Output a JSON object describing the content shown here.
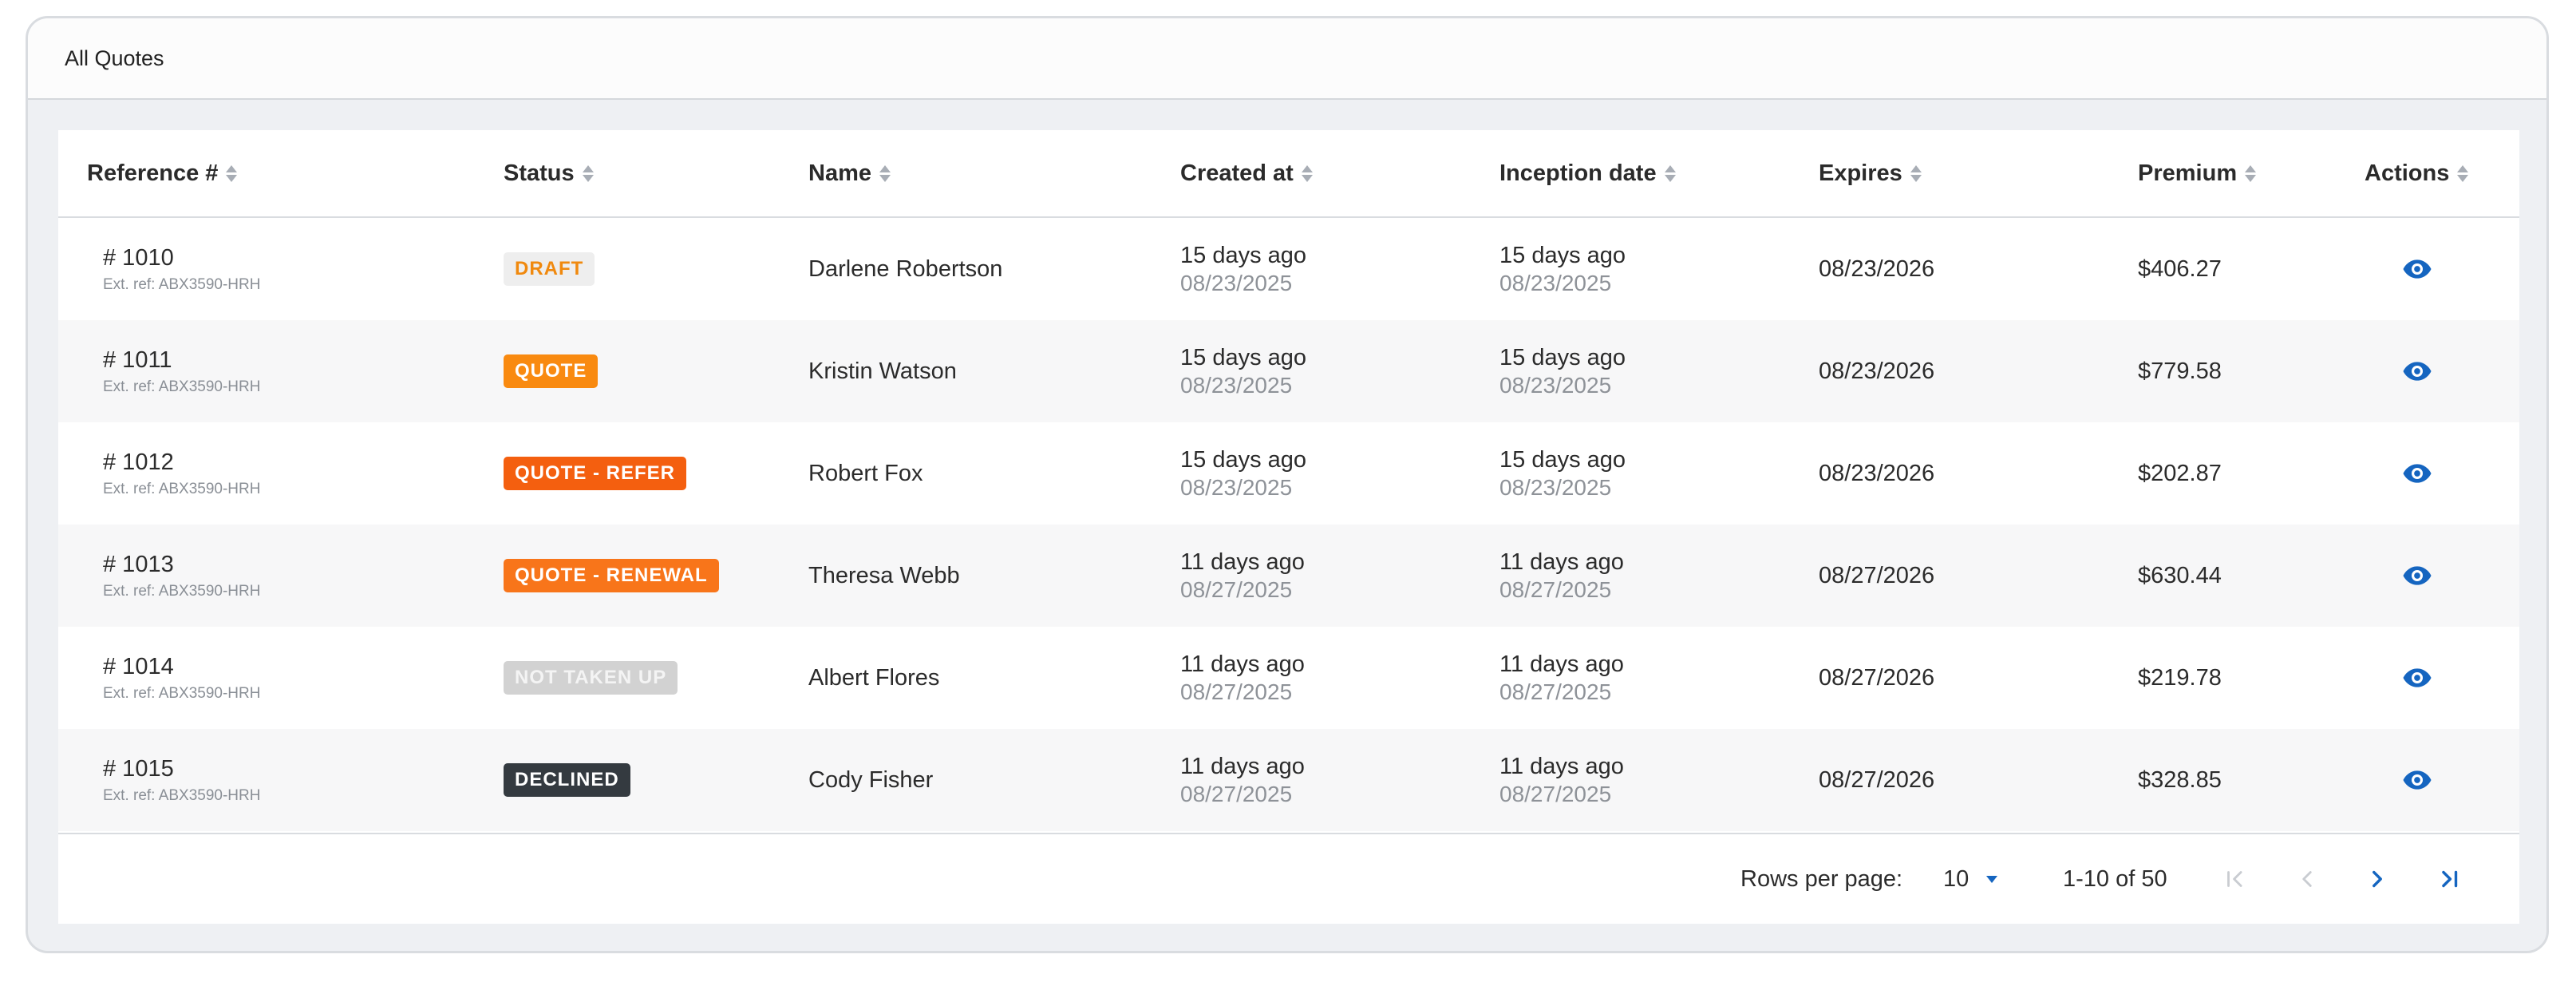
{
  "card": {
    "title": "All Quotes"
  },
  "columns": [
    {
      "key": "reference",
      "label": "Reference #"
    },
    {
      "key": "status",
      "label": "Status"
    },
    {
      "key": "name",
      "label": "Name"
    },
    {
      "key": "created_at",
      "label": "Created at"
    },
    {
      "key": "inception_date",
      "label": "Inception date"
    },
    {
      "key": "expires",
      "label": "Expires"
    },
    {
      "key": "premium",
      "label": "Premium"
    },
    {
      "key": "actions",
      "label": "Actions"
    }
  ],
  "rows": [
    {
      "reference": "# 1010",
      "ext_ref": "Ext. ref: ABX3590-HRH",
      "status": "DRAFT",
      "status_style": "draft",
      "name": "Darlene Robertson",
      "created_rel": "15 days ago",
      "created_date": "08/23/2025",
      "inception_rel": "15 days ago",
      "inception_date": "08/23/2025",
      "expires": "08/23/2026",
      "premium": "$406.27",
      "action_icon": "eye-icon"
    },
    {
      "reference": "# 1011",
      "ext_ref": "Ext. ref: ABX3590-HRH",
      "status": "QUOTE",
      "status_style": "quote",
      "name": "Kristin Watson",
      "created_rel": "15 days ago",
      "created_date": "08/23/2025",
      "inception_rel": "15 days ago",
      "inception_date": "08/23/2025",
      "expires": "08/23/2026",
      "premium": "$779.58",
      "action_icon": "eye-icon"
    },
    {
      "reference": "# 1012",
      "ext_ref": "Ext. ref: ABX3590-HRH",
      "status": "QUOTE - REFER",
      "status_style": "refer",
      "name": "Robert Fox",
      "created_rel": "15 days ago",
      "created_date": "08/23/2025",
      "inception_rel": "15 days ago",
      "inception_date": "08/23/2025",
      "expires": "08/23/2026",
      "premium": "$202.87",
      "action_icon": "eye-icon"
    },
    {
      "reference": "# 1013",
      "ext_ref": "Ext. ref: ABX3590-HRH",
      "status": "QUOTE - RENEWAL",
      "status_style": "renewal",
      "name": "Theresa Webb",
      "created_rel": "11 days ago",
      "created_date": "08/27/2025",
      "inception_rel": "11 days ago",
      "inception_date": "08/27/2025",
      "expires": "08/27/2026",
      "premium": "$630.44",
      "action_icon": "eye-icon"
    },
    {
      "reference": "# 1014",
      "ext_ref": "Ext. ref: ABX3590-HRH",
      "status": "NOT TAKEN UP",
      "status_style": "ntu",
      "name": "Albert Flores",
      "created_rel": "11 days ago",
      "created_date": "08/27/2025",
      "inception_rel": "11 days ago",
      "inception_date": "08/27/2025",
      "expires": "08/27/2026",
      "premium": "$219.78",
      "action_icon": "eye-icon"
    },
    {
      "reference": "# 1015",
      "ext_ref": "Ext. ref: ABX3590-HRH",
      "status": "DECLINED",
      "status_style": "declined",
      "name": "Cody Fisher",
      "created_rel": "11 days ago",
      "created_date": "08/27/2025",
      "inception_rel": "11 days ago",
      "inception_date": "08/27/2025",
      "expires": "08/27/2026",
      "premium": "$328.85",
      "action_icon": "eye-icon"
    }
  ],
  "status_styles": {
    "draft": {
      "bg": "#eeeeee",
      "fg": "#f0890e"
    },
    "quote": {
      "bg": "#f98a10",
      "fg": "#ffffff"
    },
    "refer": {
      "bg": "#f45f0f",
      "fg": "#ffffff"
    },
    "renewal": {
      "bg": "#f8751a",
      "fg": "#ffffff"
    },
    "ntu": {
      "bg": "#d2d2d2",
      "fg": "#f4f4f4"
    },
    "declined": {
      "bg": "#343a40",
      "fg": "#ffffff"
    }
  },
  "pagination": {
    "rows_per_page_label": "Rows per page:",
    "rows_per_page_value": "10",
    "range_text": "1-10 of 50",
    "icons": [
      "first-page-icon",
      "prev-page-icon",
      "next-page-icon",
      "last-page-icon"
    ]
  },
  "colors": {
    "accent": "#1565c0",
    "disabled_icon": "#c9ccd1",
    "header_text": "#2b2b2b",
    "muted_text": "#8e9298"
  }
}
